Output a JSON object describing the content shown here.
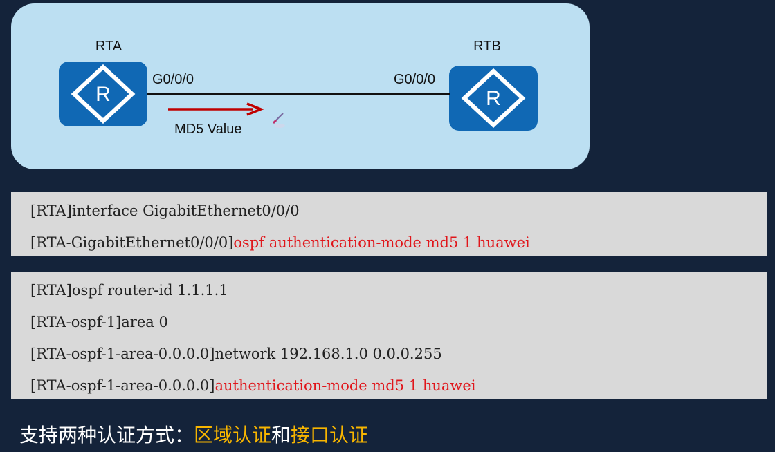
{
  "diagram": {
    "router_a": {
      "name": "RTA",
      "port": "G0/0/0",
      "icon": "router-icon"
    },
    "router_b": {
      "name": "RTB",
      "port": "G0/0/0",
      "icon": "router-icon"
    },
    "arrow_label": "MD5 Value",
    "colors": {
      "panel": "#bcdff2",
      "router": "#1068b4",
      "arrow": "#c00000"
    }
  },
  "interface_config": {
    "lines": [
      {
        "prompt": "[RTA]interface GigabitEthernet0/0/0",
        "command": ""
      },
      {
        "prompt": "[RTA-GigabitEthernet0/0/0]",
        "command": "ospf authentication-mode md5 1 huawei"
      }
    ]
  },
  "area_config": {
    "lines": [
      {
        "prompt": "[RTA]ospf router-id 1.1.1.1",
        "command": ""
      },
      {
        "prompt": "[RTA-ospf-1]area 0",
        "command": ""
      },
      {
        "prompt": "[RTA-ospf-1-area-0.0.0.0]network 192.168.1.0 0.0.0.255",
        "command": ""
      },
      {
        "prompt": "[RTA-ospf-1-area-0.0.0.0]",
        "command": "authentication-mode md5 1 huawei"
      }
    ]
  },
  "footer": {
    "prefix": "支持两种认证方式：",
    "highlight1": "区域认证",
    "connector": "和",
    "highlight2": "接口认证",
    "colors": {
      "text": "#ffffff",
      "highlight": "#f7b500"
    }
  }
}
